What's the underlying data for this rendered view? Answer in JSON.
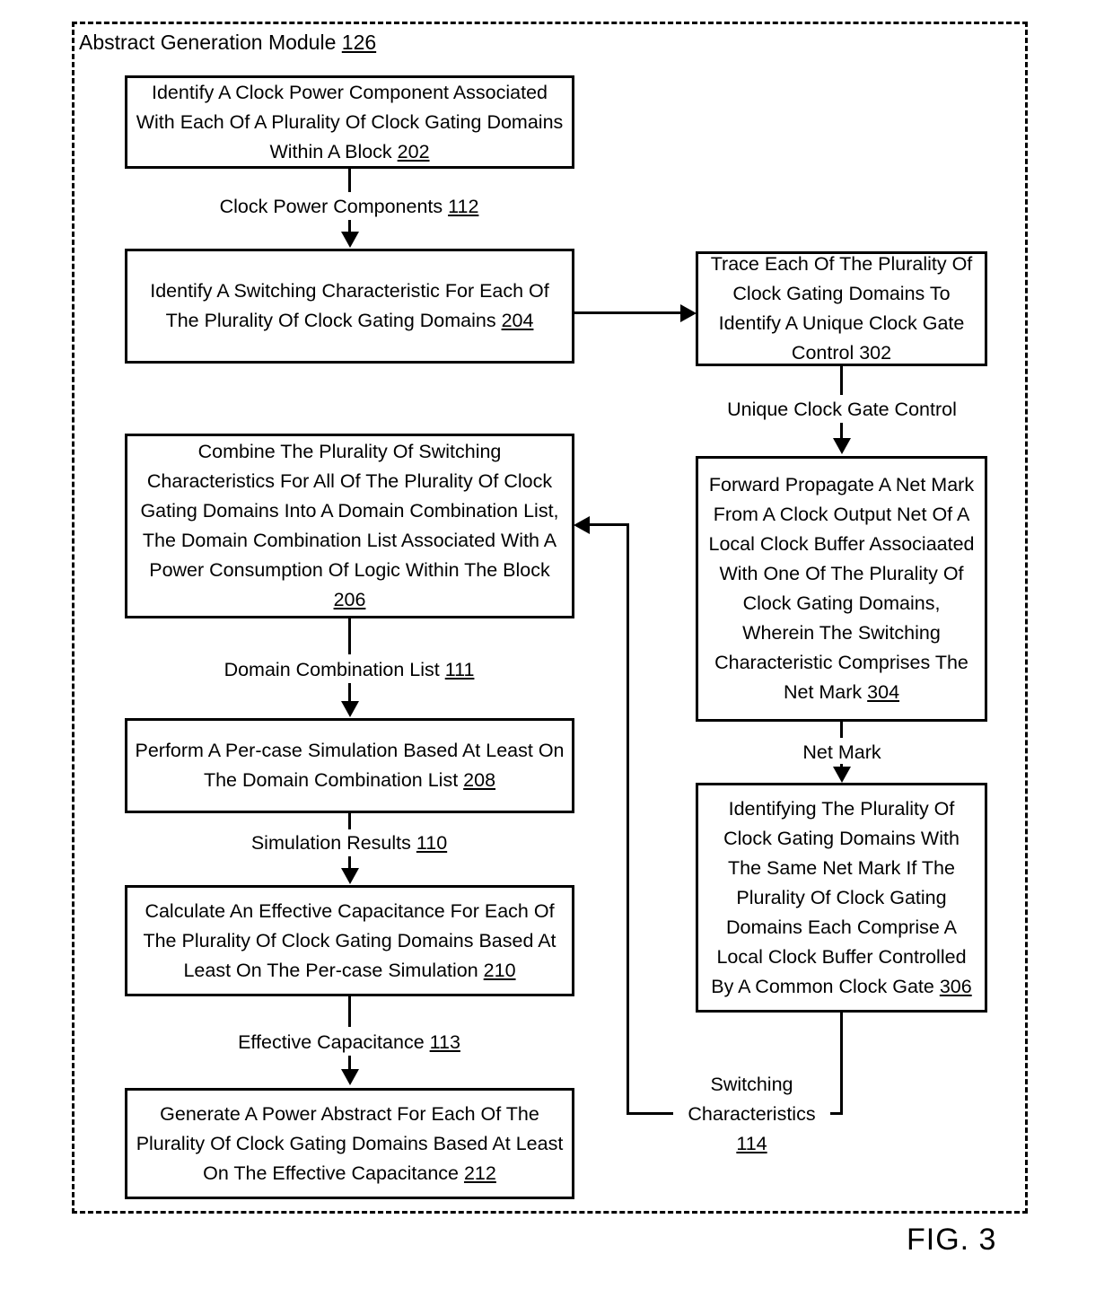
{
  "figure": {
    "caption": "FIG. 3"
  },
  "module": {
    "title_text": "Abstract Generation Module ",
    "title_ref": "126"
  },
  "left_column": {
    "boxes": [
      {
        "id": "box-202",
        "text": "Identify A Clock Power Component Associated With Each Of A Plurality Of Clock Gating Domains Within A Block ",
        "ref": "202"
      },
      {
        "id": "box-204",
        "text": "Identify A Switching Characteristic For Each Of The Plurality Of Clock Gating Domains ",
        "ref": "204"
      },
      {
        "id": "box-206",
        "text": "Combine The Plurality Of Switching Characteristics For All Of The Plurality Of Clock Gating Domains Into A Domain Combination List, The Domain Combination List Associated With A Power Consumption Of Logic Within The Block ",
        "ref": "206"
      },
      {
        "id": "box-208",
        "text": "Perform A Per-case Simulation Based At Least On The Domain Combination List ",
        "ref": "208"
      },
      {
        "id": "box-210",
        "text": "Calculate An Effective Capacitance For Each Of The Plurality Of Clock Gating Domains Based At Least On The Per-case Simulation  ",
        "ref": "210"
      },
      {
        "id": "box-212",
        "text": "Generate A Power Abstract For Each Of The Plurality Of Clock Gating Domains Based At Least On The Effective Capacitance  ",
        "ref": "212"
      }
    ],
    "edge_labels": [
      {
        "id": "edge-112",
        "text": "Clock Power Components ",
        "ref": "112"
      },
      {
        "id": "edge-111",
        "text": "Domain Combination List ",
        "ref": "111"
      },
      {
        "id": "edge-110",
        "text": "Simulation Results ",
        "ref": "110"
      },
      {
        "id": "edge-113",
        "text": "Effective Capacitance ",
        "ref": "113"
      }
    ]
  },
  "right_column": {
    "boxes": [
      {
        "id": "box-302",
        "text": "Trace Each Of The Plurality Of Clock Gating Domains To Identify A Unique Clock Gate Control 302",
        "ref": ""
      },
      {
        "id": "box-304",
        "text": "Forward Propagate A Net Mark From A Clock Output Net Of A Local Clock Buffer Associaated With One Of The Plurality Of Clock Gating Domains, Wherein The Switching Characteristic Comprises The Net Mark ",
        "ref": "304"
      },
      {
        "id": "box-306",
        "text": "Identifying The Plurality Of Clock Gating Domains With The Same Net Mark If The Plurality Of Clock Gating Domains Each Comprise A Local Clock Buffer Controlled By A Common Clock Gate ",
        "ref": "306"
      }
    ],
    "edge_labels": [
      {
        "id": "edge-unique-clock-gate-control",
        "text": "Unique Clock Gate Control",
        "ref": ""
      },
      {
        "id": "edge-net-mark",
        "text": "Net Mark",
        "ref": ""
      }
    ]
  },
  "feedback": {
    "label_line1": "Switching",
    "label_line2": "Characteristics",
    "ref": "114"
  }
}
